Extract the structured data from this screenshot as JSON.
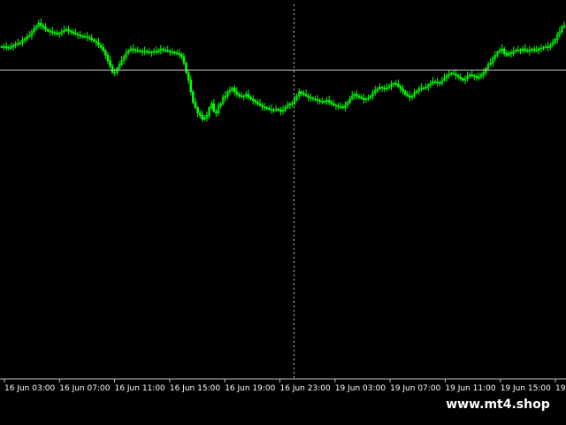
{
  "watermark": "www.mt4.shop",
  "colors": {
    "background": "#000000",
    "candle": "#00ff00",
    "grid": "#c0c0c0",
    "axis_text": "#ffffff"
  },
  "chart_data": {
    "type": "candlestick",
    "title": "",
    "xlabel": "",
    "ylabel": "",
    "x_ticks": [
      "16 Jun 03:00",
      "16 Jun 07:00",
      "16 Jun 11:00",
      "16 Jun 15:00",
      "16 Jun 19:00",
      "16 Jun 23:00",
      "19 Jun 03:00",
      "19 Jun 07:00",
      "19 Jun 11:00",
      "19 Jun 15:00",
      "19 J"
    ],
    "horizontal_line": 103,
    "crosshair_x_index": 5,
    "ylim": [
      0,
      170
    ],
    "series": [
      {
        "close": [
          133,
          133,
          132,
          131,
          133,
          135,
          136,
          137,
          138,
          141,
          143,
          146,
          147,
          152,
          156,
          159,
          163,
          160,
          158,
          155,
          153,
          152,
          151,
          150,
          149,
          150,
          152,
          154,
          155,
          153,
          152,
          150,
          149,
          148,
          147,
          146,
          146,
          145,
          144,
          142,
          140,
          138,
          135,
          132,
          128,
          122,
          115,
          108,
          100,
          100,
          105,
          110,
          115,
          120,
          125,
          128,
          130,
          129,
          128,
          128,
          127,
          126,
          127,
          126,
          125,
          126,
          127,
          126,
          128,
          130,
          129,
          128,
          127,
          126,
          126,
          125,
          124,
          123,
          120,
          112,
          100,
          90,
          75,
          62,
          55,
          48,
          45,
          40,
          42,
          45,
          55,
          60,
          50,
          48,
          57,
          60,
          68,
          70,
          75,
          77,
          80,
          75,
          72,
          70,
          69,
          70,
          72,
          68,
          66,
          64,
          62,
          60,
          58,
          56,
          55,
          54,
          53,
          52,
          52,
          53,
          52,
          50,
          52,
          55,
          58,
          60,
          60,
          65,
          70,
          75,
          73,
          72,
          70,
          68,
          67,
          66,
          65,
          64,
          63,
          62,
          63,
          64,
          62,
          60,
          58,
          57,
          56,
          56,
          55,
          58,
          62,
          66,
          70,
          72,
          70,
          68,
          67,
          65,
          66,
          67,
          70,
          74,
          77,
          79,
          81,
          80,
          79,
          80,
          82,
          85,
          86,
          85,
          82,
          79,
          76,
          72,
          70,
          68,
          70,
          74,
          76,
          79,
          80,
          80,
          81,
          84,
          86,
          88,
          88,
          87,
          86,
          90,
          93,
          96,
          98,
          99,
          98,
          96,
          94,
          92,
          90,
          92,
          95,
          97,
          96,
          95,
          93,
          94,
          97,
          100,
          105,
          110,
          112,
          118,
          122,
          126,
          128,
          130,
          124,
          122,
          125,
          124,
          127,
          128,
          129,
          128,
          130,
          128,
          127,
          129,
          130,
          128,
          128,
          130,
          131,
          132,
          133,
          132,
          135,
          138,
          142,
          148,
          152,
          158,
          160
        ]
      }
    ]
  }
}
